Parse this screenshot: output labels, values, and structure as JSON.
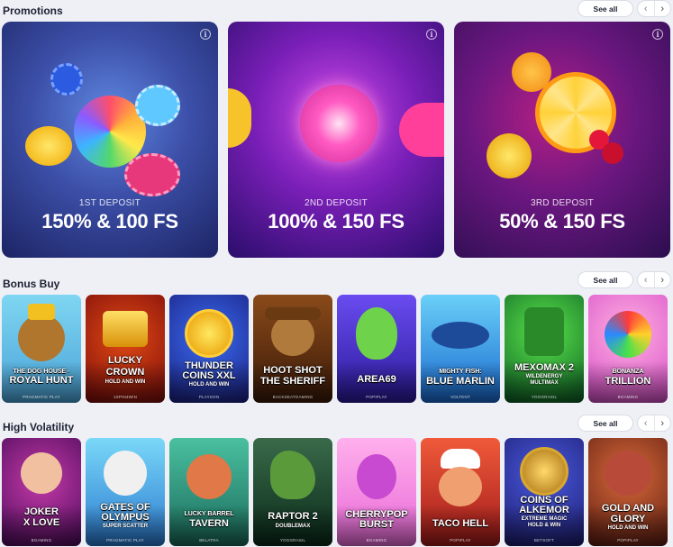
{
  "sections": {
    "promotions": {
      "title": "Promotions",
      "see_all": "See all"
    },
    "bonus_buy": {
      "title": "Bonus Buy",
      "see_all": "See all"
    },
    "high_volatility": {
      "title": "High Volatility",
      "see_all": "See all"
    }
  },
  "arrows": {
    "prev": "‹",
    "next": "›"
  },
  "info_glyph": "i",
  "promotions": [
    {
      "label": "1ST DEPOSIT",
      "offer": "150% & 100 FS"
    },
    {
      "label": "2ND DEPOSIT",
      "offer": "100% & 150 FS"
    },
    {
      "label": "3RD DEPOSIT",
      "offer": "50% & 150 FS"
    }
  ],
  "bonus_buy": [
    {
      "line1": "THE DOG HOUSE -",
      "line2": "ROYAL HUNT",
      "provider": "PRAGMATIC PLAY"
    },
    {
      "line1": "LUCKY",
      "line2": "CROWN",
      "sub": "HOLD AND WIN",
      "provider": "1SPIN4WIN"
    },
    {
      "line1": "THUNDER",
      "line2": "COINS XXL",
      "sub": "HOLD AND WIN",
      "provider": "PLAYSON"
    },
    {
      "line1": "HOOT SHOT",
      "line2": "THE SHERIFF",
      "provider": "BACKSEATGAMING"
    },
    {
      "line1": "AREA69",
      "provider": "POPIPLAY"
    },
    {
      "line1": "MIGHTY FISH:",
      "line2": "BLUE MARLIN",
      "provider": "VOLTENT"
    },
    {
      "line1": "MEXOMAX 2",
      "sub": "WILDENERGY",
      "sub2": "MULTIMAX",
      "provider": "YOGGRASIL"
    },
    {
      "line1": "BONANZA",
      "line2": "TRILLION",
      "provider": "BGAMING"
    }
  ],
  "high_volatility": [
    {
      "line1": "JOKER",
      "line2": "X LOVE",
      "provider": "BGAMING"
    },
    {
      "line1": "GATES OF",
      "line2": "OLYMPUS",
      "sub": "SUPER SCATTER",
      "provider": "PRAGMATIC PLAY"
    },
    {
      "line1": "LUCKY BARREL",
      "line2": "TAVERN",
      "provider": "BELATRA"
    },
    {
      "line1": "RAPTOR 2",
      "sub": "DOUBLEMAX",
      "provider": "YOGGRASIL"
    },
    {
      "line1": "CHERRYPOP",
      "line2": "BURST",
      "provider": "BGAMING"
    },
    {
      "line1": "TACO HELL",
      "provider": "POPIPLAY"
    },
    {
      "line1": "COINS OF",
      "line2": "ALKEMOR",
      "sub": "EXTREME MAGIC",
      "sub2": "HOLD & WIN",
      "provider": "BETSOFT"
    },
    {
      "line1": "GOLD AND",
      "line2": "GLORY",
      "sub": "HOLD AND WIN",
      "provider": "POPIPLAY"
    }
  ]
}
